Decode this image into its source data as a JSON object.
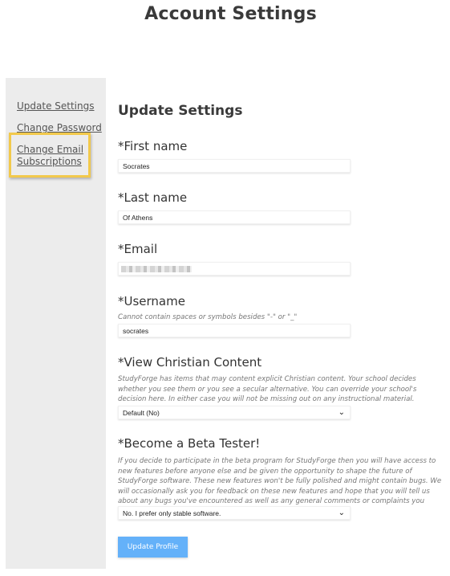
{
  "header": {
    "title": "Account Settings"
  },
  "sidebar": {
    "items": [
      {
        "label": "Update Settings"
      },
      {
        "label": "Change Password"
      },
      {
        "label": "Change Email Subscriptions",
        "highlighted": true
      }
    ],
    "highlight_color": "#f2c94c"
  },
  "form": {
    "title": "Update Settings",
    "first_name": {
      "label": "*First name",
      "value": "Socrates"
    },
    "last_name": {
      "label": "*Last name",
      "value": "Of Athens"
    },
    "email": {
      "label": "*Email",
      "value": "(blurred)"
    },
    "username": {
      "label": "*Username",
      "hint": "Cannot contain spaces or symbols besides \"-\" or \"_\"",
      "value": "socrates"
    },
    "christian_content": {
      "label": "*View Christian Content",
      "hint": "StudyForge has items that may content explicit Christian content. Your school decides whether you see them or you see a secular alternative. You can override your school's decision here. In either case you will not be missing out on any instructional material.",
      "selected": "Default (No)"
    },
    "beta_tester": {
      "label": "*Become a Beta Tester!",
      "hint": "If you decide to participate in the beta program for StudyForge then you will have access to new features before anyone else and be given the opportunity to shape the future of StudyForge software. These new features won't be fully polished and might contain bugs. We will occasionally ask you for feedback on these new features and hope that you will tell us about any bugs you've encountered as well as any general comments or complaints you might have.",
      "selected": "No. I prefer only stable software."
    },
    "submit_label": "Update Profile",
    "submit_color": "#64b1f9"
  }
}
